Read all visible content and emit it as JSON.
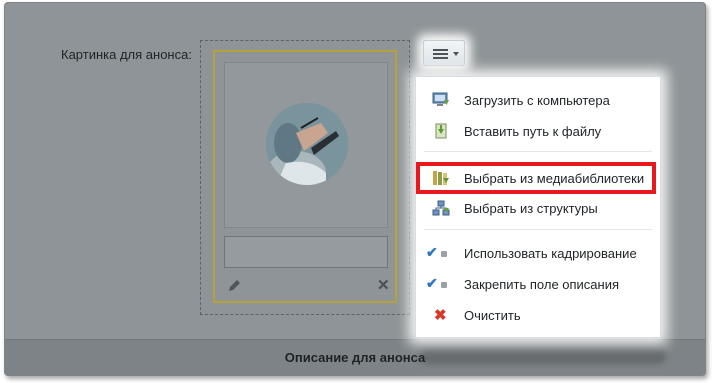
{
  "form": {
    "announce_image_label": "Картинка для анонса:",
    "description_section_title": "Описание для анонса"
  },
  "menu": {
    "button_icon": "hamburger-icon",
    "items": [
      {
        "label": "Загрузить с компьютера",
        "icon": "upload-computer-icon"
      },
      {
        "label": "Вставить путь к файлу",
        "icon": "insert-path-icon"
      },
      {
        "label": "Выбрать из медиабиблиотеки",
        "icon": "media-library-icon"
      },
      {
        "label": "Выбрать из структуры",
        "icon": "structure-icon"
      },
      {
        "label": "Использовать кадрирование",
        "icon": "checkmark-icon"
      },
      {
        "label": "Закрепить поле описания",
        "icon": "checkmark-icon"
      },
      {
        "label": "Очистить",
        "icon": "red-x-icon"
      }
    ]
  },
  "colors": {
    "highlight": "#e8181d",
    "card_border": "#b4a23c",
    "check": "#2f77c0",
    "clear_icon": "#d8392b"
  }
}
